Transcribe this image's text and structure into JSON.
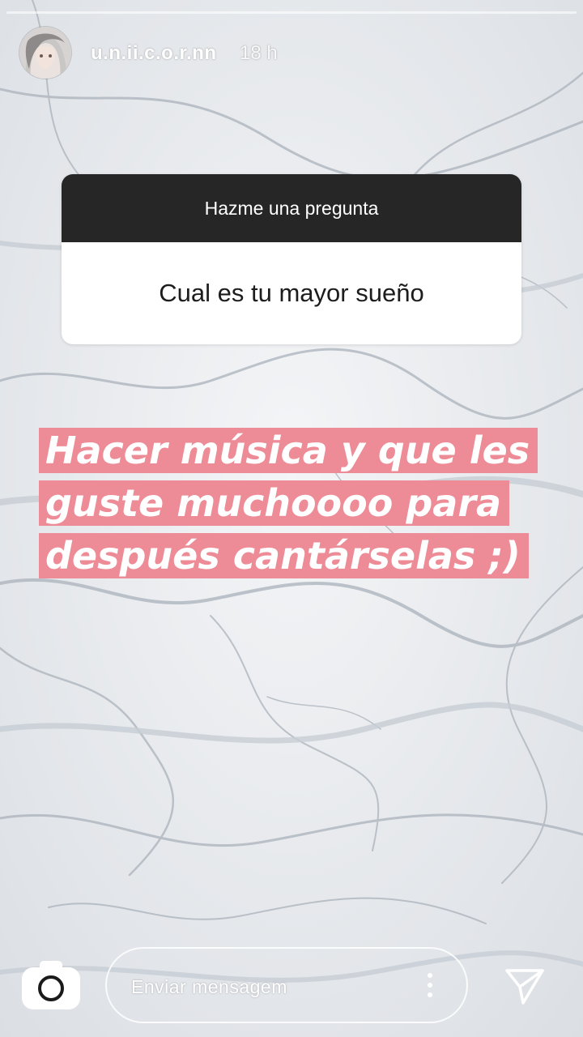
{
  "header": {
    "username": "u.n.ii.c.o.r.nn",
    "time": "18 h",
    "avatar_icon": "profile-avatar"
  },
  "question_sticker": {
    "prompt": "Hazme una pregunta",
    "question": "Cual es tu mayor sueño"
  },
  "answer": {
    "lines": [
      "Hacer música y que les",
      "guste muchoooo para",
      "después cantárselas ;)"
    ],
    "highlight_color": "#ed8b96"
  },
  "footer": {
    "message_placeholder": "Enviar mensagem",
    "camera_icon": "camera-icon",
    "more_icon": "more-options-icon",
    "send_icon": "direct-send-icon"
  },
  "colors": {
    "question_header": "#262626",
    "question_body": "#ffffff"
  }
}
